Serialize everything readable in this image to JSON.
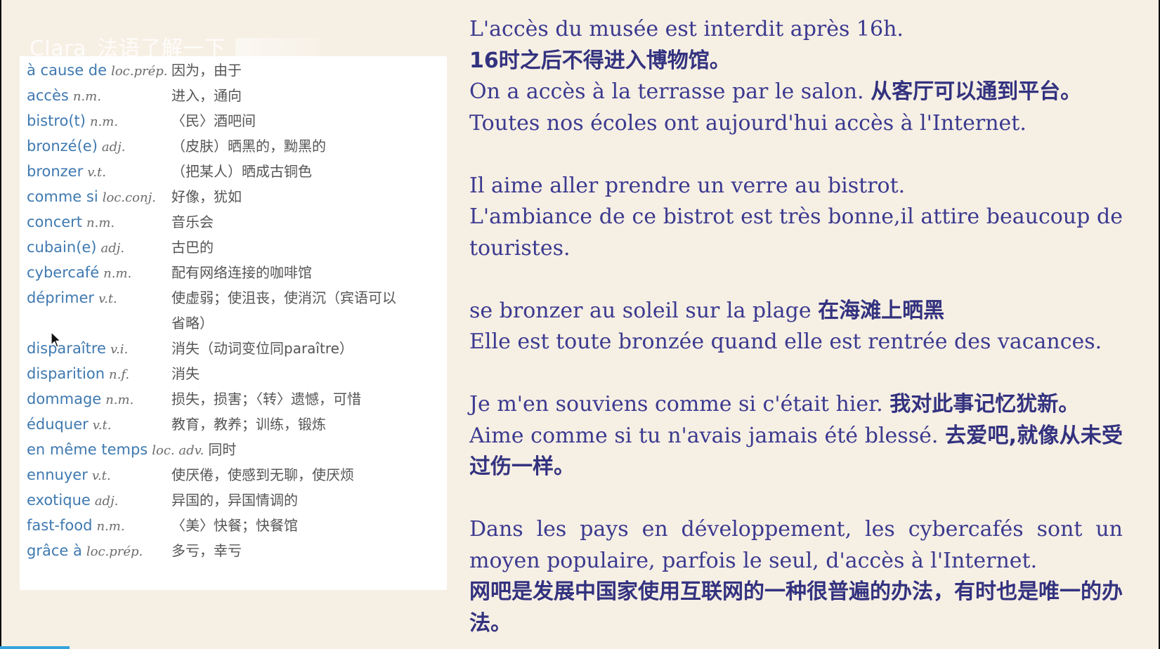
{
  "watermark": {
    "text": "Clara_法语了解一下"
  },
  "vocabulary": [
    {
      "word": "à cause de",
      "pos": "loc.prép.",
      "def": "因为，由于"
    },
    {
      "word": "accès",
      "pos": "n.m.",
      "def": "进入，通向"
    },
    {
      "word": "bistro(t)",
      "pos": "n.m.",
      "def": "〈民〉酒吧间"
    },
    {
      "word": "bronzé(e)",
      "pos": "adj.",
      "def": "（皮肤）晒黑的，黝黑的"
    },
    {
      "word": "bronzer",
      "pos": "v.t.",
      "def": "（把某人）晒成古铜色"
    },
    {
      "word": "comme si",
      "pos": "loc.conj.",
      "def": "好像，犹如"
    },
    {
      "word": "concert",
      "pos": "n.m.",
      "def": "音乐会"
    },
    {
      "word": "cubain(e)",
      "pos": "adj.",
      "def": "古巴的"
    },
    {
      "word": "cybercafé",
      "pos": "n.m.",
      "def": "配有网络连接的咖啡馆"
    },
    {
      "word": "déprimer",
      "pos": "v.t.",
      "def": "使虚弱；使沮丧，使消沉（宾语可以"
    },
    {
      "word": "",
      "pos": "",
      "def": "省略）"
    },
    {
      "word": "disparaître",
      "pos": "v.i.",
      "def": "消失（动词变位同paraître）"
    },
    {
      "word": "disparition",
      "pos": "n.f.",
      "def": "消失"
    },
    {
      "word": "dommage",
      "pos": "n.m.",
      "def": "损失，损害；〈转〉遗憾，可惜"
    },
    {
      "word": "éduquer",
      "pos": "v.t.",
      "def": "教育，教养；训练，锻炼"
    },
    {
      "word": "en même temps",
      "pos": "loc. adv.",
      "def": "同时"
    },
    {
      "word": "ennuyer",
      "pos": "v.t.",
      "def": "使厌倦，使感到无聊，使厌烦"
    },
    {
      "word": "exotique",
      "pos": "adj.",
      "def": "异国的，异国情调的"
    },
    {
      "word": "fast-food",
      "pos": "n.m.",
      "def": "〈美〉快餐；快餐馆"
    },
    {
      "word": "grâce à",
      "pos": "loc.prép.",
      "def": "多亏，幸亏"
    }
  ],
  "examples": {
    "s1": "L'accès du musée est interdit après 16h.",
    "s1_zh": "16时之后不得进入博物馆。",
    "s2": "On a accès à la terrasse par le salon. ",
    "s2_zh": "从客厅可以通到平台。",
    "s3": "Toutes nos écoles ont aujourd'hui accès à l'Internet.",
    "s4": "Il aime aller prendre un verre au bistrot.",
    "s5": "L'ambiance de ce bistrot est très bonne,il attire beaucoup de touristes.",
    "s6": "se bronzer au soleil sur la plage ",
    "s6_zh": "在海滩上晒黑",
    "s7": "Elle est toute bronzée quand elle est rentrée des vacances.",
    "s8": "Je m'en souviens comme si c'était hier. ",
    "s8_zh": "我对此事记忆犹新。",
    "s9": "Aime comme si tu n'avais jamais été blessé. ",
    "s9_zh": "去爱吧,就像从未受过伤一样。",
    "s10": "Dans les pays en développement, les cybercafés sont un moyen populaire, parfois le seul, d'accès à l'Internet.",
    "s10_zh": "网吧是发展中国家使用互联网的一种很普遍的办法，有时也是唯一的办法。"
  },
  "colors": {
    "background": "#f6efe4",
    "vocab_word": "#3f79b0",
    "example_text": "#3b3a8f",
    "progress": "#34a3dd"
  },
  "icons": {
    "cursor": "mouse-pointer-icon"
  },
  "video_progress": 0.06
}
